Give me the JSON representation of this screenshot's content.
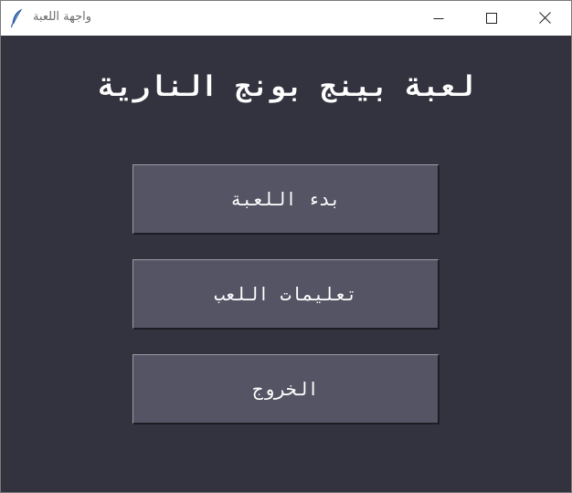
{
  "window": {
    "title": "واجهة اللعبة",
    "icon": "feather-icon"
  },
  "controls": {
    "minimize_icon": "minimize-icon",
    "maximize_icon": "maximize-icon",
    "close_icon": "close-icon"
  },
  "main": {
    "title": "لعبة بينج بونج النارية",
    "buttons": [
      {
        "label": "بدء اللعبة"
      },
      {
        "label": "تعليمات اللعب"
      },
      {
        "label": "الخروج"
      }
    ]
  },
  "colors": {
    "background": "#33323f",
    "button_face": "#555464",
    "text": "#ffffff"
  }
}
